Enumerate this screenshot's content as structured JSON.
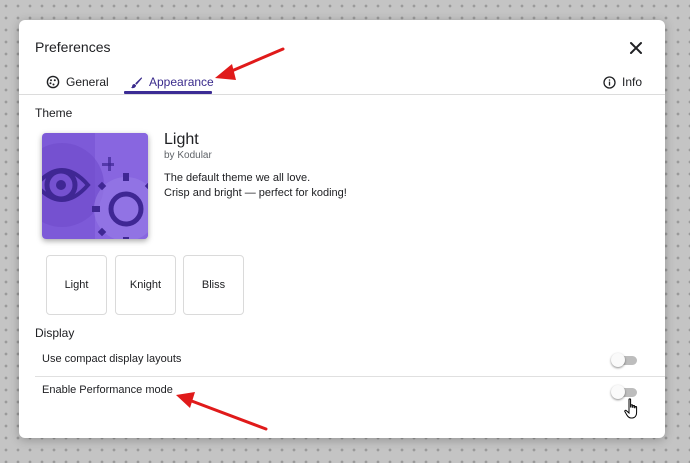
{
  "dialog": {
    "title": "Preferences",
    "close_icon": "close-icon"
  },
  "tabs": [
    {
      "label": "General",
      "icon": "palette-icon",
      "active": false
    },
    {
      "label": "Appearance",
      "icon": "brush-icon",
      "active": true
    },
    {
      "label": "Info",
      "icon": "info-icon",
      "active": false
    }
  ],
  "theme": {
    "section_label": "Theme",
    "name": "Light",
    "author": "by Kodular",
    "description_line1": "The default theme we all love.",
    "description_line2": "Crisp and bright — perfect for koding!",
    "options": [
      "Light",
      "Knight",
      "Bliss"
    ]
  },
  "display": {
    "section_label": "Display",
    "settings": [
      {
        "label": "Use compact display layouts",
        "enabled": false
      },
      {
        "label": "Enable Performance mode",
        "enabled": false
      }
    ]
  },
  "colors": {
    "accent": "#3c2c95",
    "annotation_arrow": "#e01a1a",
    "thumb_purple": "#7c5ad6"
  }
}
